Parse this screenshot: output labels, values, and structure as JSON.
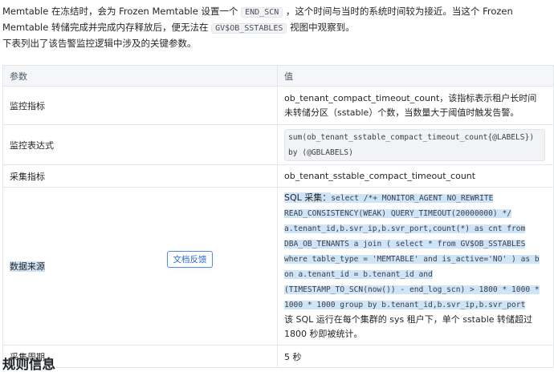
{
  "intro": {
    "p1_a": "Memtable 在冻结时，会为 Frozen Memtable 设置一个 ",
    "p1_code": "END_SCN",
    "p1_b": " ，这个时间与当时的系统时间较为接近。当这个 Frozen Memtable 转储完成并完成内存释放后，便无法在 ",
    "p1_code2": "GV$OB_SSTABLES",
    "p1_c": " 视图中观察到。",
    "p2": "下表列出了该告警监控逻辑中涉及的关键参数。"
  },
  "table": {
    "headers": [
      "参数",
      "值"
    ],
    "rows": [
      {
        "param": "监控指标",
        "value": "ob_tenant_compact_timeout_count，该指标表示租户长时间未转储分区（sstable）个数，当数量大于阈值时触发告警。"
      },
      {
        "param": "监控表达式",
        "value": "sum(ob_tenant_sstable_compact_timeout_count{@LABELS}) by (@GBLABELS)"
      },
      {
        "param": "采集指标",
        "value": "ob_tenant_sstable_compact_timeout_count"
      },
      {
        "param": "数据来源",
        "value_prefix": "SQL 采集：",
        "value_sql": "select /*+ MONITOR_AGENT NO_REWRITE READ_CONSISTENCY(WEAK) QUERY_TIMEOUT(20000000) */ a.tenant_id,b.svr_ip,b.svr_port,count(*) as cnt from DBA_OB_TENANTS a join ( select * from GV$OB_SSTABLES where table_type = 'MEMTABLE' and is_active='NO' ) as b on a.tenant_id = b.tenant_id and (TIMESTAMP_TO_SCN(now()) - end_log_scn) > 1800 * 1000 * 1000 * 1000 group by b.tenant_id,b.svr_ip,b.svr_port",
        "value_note": "该 SQL 运行在每个集群的 sys 租户下，单个 sstable 转储超过 1800 秒即被统计。"
      },
      {
        "param": "采集周期",
        "value": "5 秒"
      }
    ]
  },
  "feedback_button": "文档反馈",
  "section_heading": "规则信息"
}
